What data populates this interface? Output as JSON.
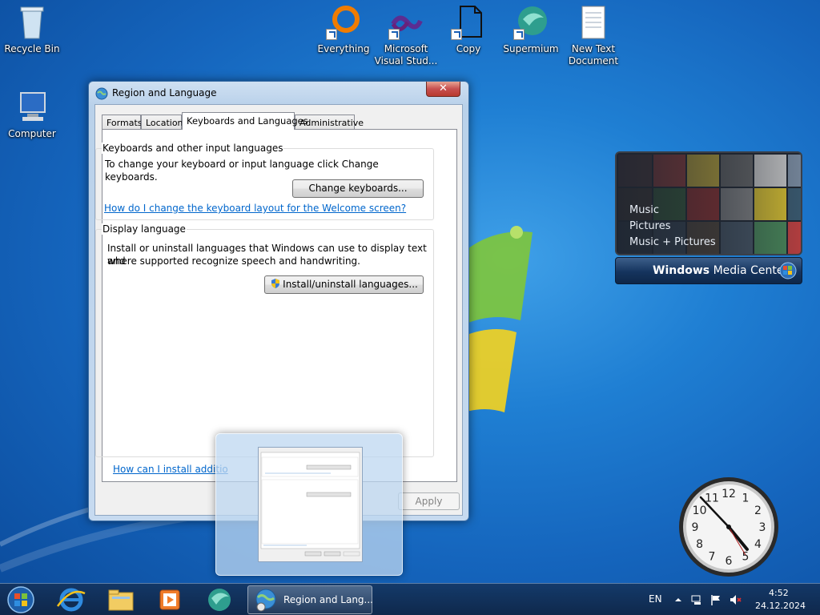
{
  "desktop": {
    "icons": [
      {
        "label": "Recycle Bin"
      },
      {
        "label": "Computer"
      },
      {
        "label": "Everything"
      },
      {
        "label": "Microsoft Visual Stud..."
      },
      {
        "label": "Copy"
      },
      {
        "label": "Supermium"
      },
      {
        "label": "New Text Document"
      }
    ]
  },
  "window": {
    "title": "Region and Language",
    "close_glyph": "✕",
    "tabs": [
      {
        "label": "Formats"
      },
      {
        "label": "Location"
      },
      {
        "label": "Keyboards and Languages",
        "active": true
      },
      {
        "label": "Administrative"
      }
    ],
    "keyboards_group": {
      "title": "Keyboards and other input languages",
      "description": "To change your keyboard or input language click Change keyboards.",
      "button": "Change keyboards...",
      "link": "How do I change the keyboard layout for the Welcome screen?"
    },
    "display_group": {
      "title": "Display language",
      "description_line1": "Install or uninstall languages that Windows can use to display text and",
      "description_line2": "where supported recognize speech and handwriting.",
      "button": "Install/uninstall languages..."
    },
    "bottom_link": "How can I install additio",
    "apply_button": "Apply"
  },
  "media_center": {
    "menu": [
      "Music",
      "Pictures",
      "Music + Pictures"
    ],
    "bar_label_bold": "Windows",
    "bar_label": " Media Center"
  },
  "clock_gadget": {
    "numbers": [
      "12",
      "1",
      "2",
      "3",
      "4",
      "5",
      "6",
      "7",
      "8",
      "9",
      "10",
      "11"
    ],
    "time": "4:52"
  },
  "taskbar": {
    "task_label": "Region and Lang...",
    "language": "EN",
    "time": "4:52",
    "date": "24.12.2024"
  },
  "colors": {
    "accent": "#1f7fd3",
    "link": "#0066cc",
    "close_red": "#c75050"
  }
}
